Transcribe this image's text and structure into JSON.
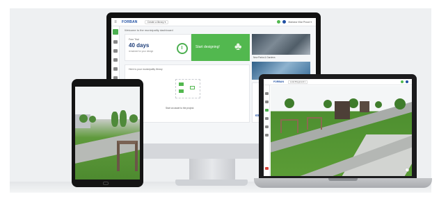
{
  "desktop": {
    "brand": "FORBAN",
    "workspace_select": "Create a library ▾",
    "user_name": "Mariana Vilar Proud ▾",
    "welcome": "Welcome to the municipality dashboard",
    "trial": {
      "label": "Free Trial",
      "days": "40 days",
      "note": "remained for your design"
    },
    "design_cta": "Start designing!",
    "photo_caption": "New Parks & Gardens",
    "library_label": "Here is your municipality library",
    "library_add": "Start an asset to the project.",
    "side_label": "expe",
    "sidebar_items": 6
  },
  "laptop": {
    "brand": "FORBAN",
    "workspace_select": "Local Playground ▾",
    "user_name": "Mariana Vilar"
  },
  "colors": {
    "brand_blue": "#1f4fa3",
    "accent_green": "#52b84f",
    "grass": "#5b9c36"
  }
}
